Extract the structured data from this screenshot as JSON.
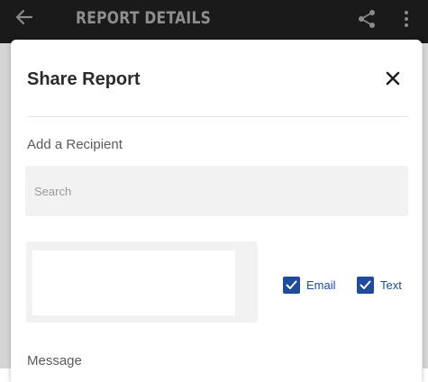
{
  "appbar": {
    "title": "REPORT DETAILS",
    "back_icon": "arrow-left-icon",
    "share_icon": "share-icon",
    "more_icon": "more-vertical-icon"
  },
  "dialog": {
    "title": "Share Report",
    "close_icon": "close-icon",
    "recipient_label": "Add a Recipient",
    "search": {
      "placeholder": "Search",
      "value": ""
    },
    "options": [
      {
        "label": "Email",
        "checked": true
      },
      {
        "label": "Text",
        "checked": true
      }
    ],
    "message_label": "Message"
  },
  "colors": {
    "appbar_bg": "#1a1a1a",
    "accent": "#1e4b9a",
    "field_bg": "#f2f2f2"
  }
}
